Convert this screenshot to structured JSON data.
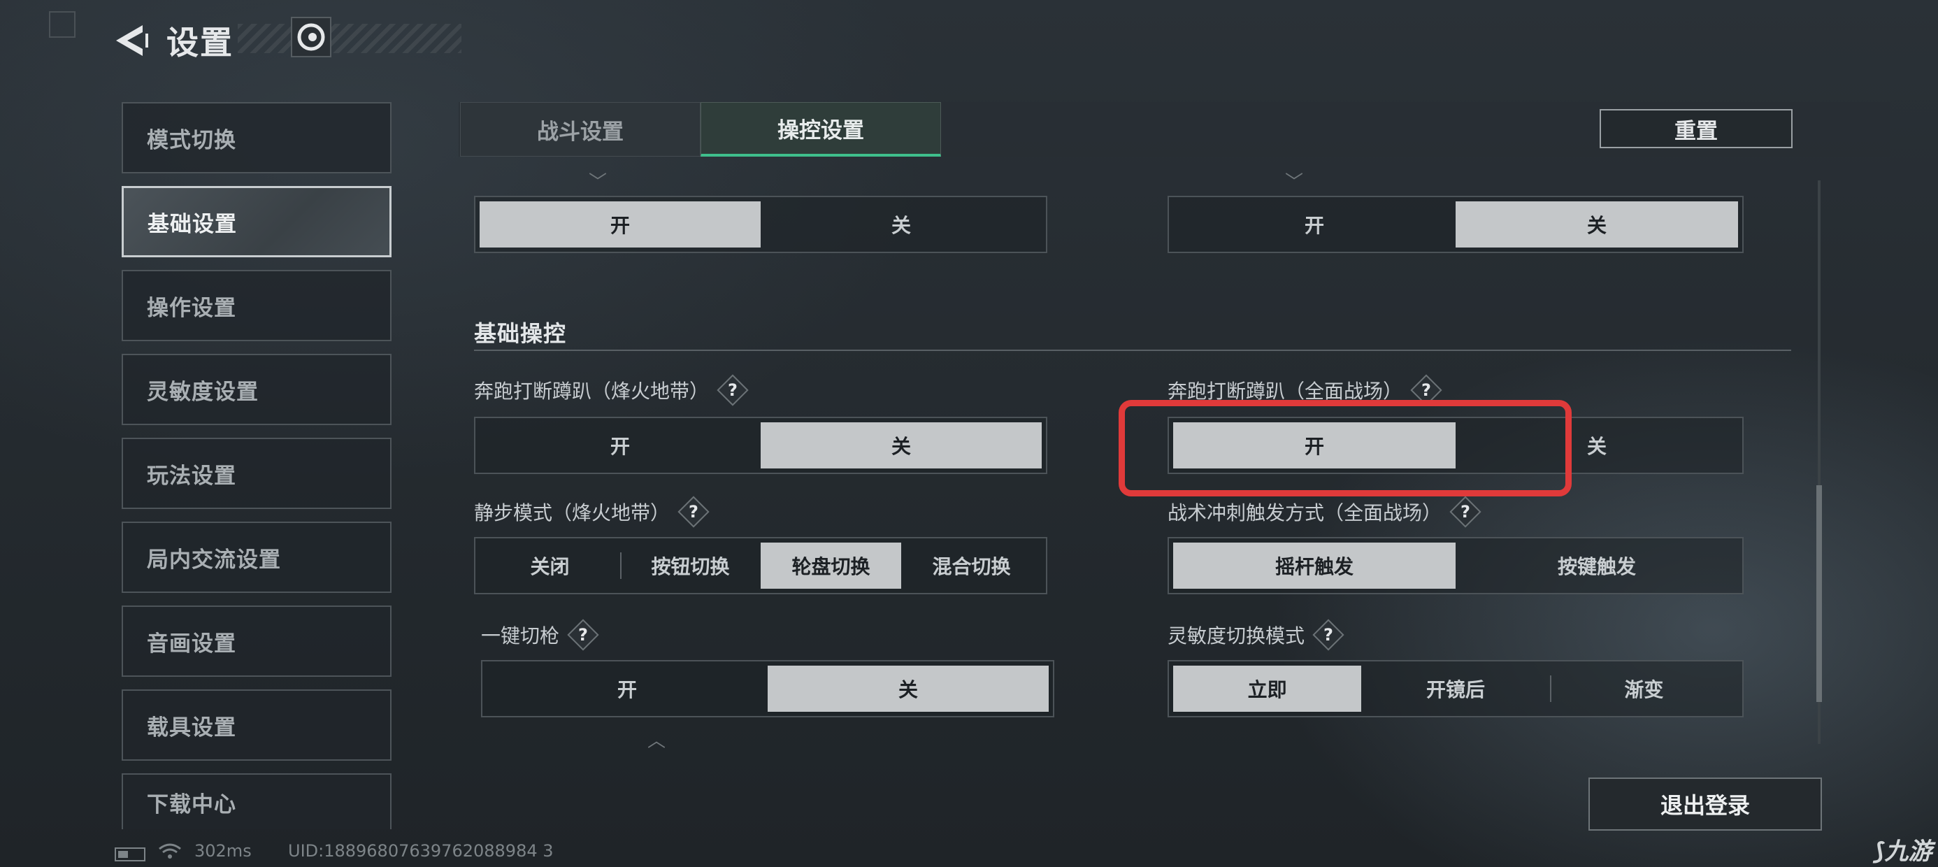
{
  "header": {
    "title": "设置"
  },
  "sidebar": {
    "items": [
      {
        "label": "模式切换"
      },
      {
        "label": "基础设置"
      },
      {
        "label": "操作设置"
      },
      {
        "label": "灵敏度设置"
      },
      {
        "label": "玩法设置"
      },
      {
        "label": "局内交流设置"
      },
      {
        "label": "音画设置"
      },
      {
        "label": "载具设置"
      },
      {
        "label": "下载中心"
      }
    ],
    "active_index": 1
  },
  "tabs": [
    {
      "label": "战斗设置",
      "active": false
    },
    {
      "label": "操控设置",
      "active": true
    }
  ],
  "reset_label": "重置",
  "top_toggles": {
    "left": {
      "options": [
        "开",
        "关"
      ],
      "selected": "开"
    },
    "right": {
      "options": [
        "开",
        "关"
      ],
      "selected": "关"
    }
  },
  "section": {
    "title": "基础操控"
  },
  "settings": {
    "sprint_interrupt_fire": {
      "label": "奔跑打断蹲趴（烽火地带）",
      "options": [
        "开",
        "关"
      ],
      "selected": "关"
    },
    "sprint_interrupt_war": {
      "label": "奔跑打断蹲趴（全面战场）",
      "options": [
        "开",
        "关"
      ],
      "selected": "开"
    },
    "silent_step": {
      "label": "静步模式（烽火地带）",
      "options": [
        "关闭",
        "按钮切换",
        "轮盘切换",
        "混合切换"
      ],
      "selected": "轮盘切换"
    },
    "tactical_dash": {
      "label": "战术冲刺触发方式（全面战场）",
      "options": [
        "摇杆触发",
        "按键触发"
      ],
      "selected": "摇杆触发"
    },
    "quick_switch": {
      "label": "一键切枪",
      "options": [
        "开",
        "关"
      ],
      "selected": "关"
    },
    "sensitivity_mode": {
      "label": "灵敏度切换模式",
      "options": [
        "立即",
        "开镜后",
        "渐变"
      ],
      "selected": "立即"
    }
  },
  "help_glyph": "?",
  "logout_label": "退出登录",
  "status": {
    "ping": "302ms",
    "uid": "UID:18896807639762088984 3"
  },
  "watermark": "九游"
}
